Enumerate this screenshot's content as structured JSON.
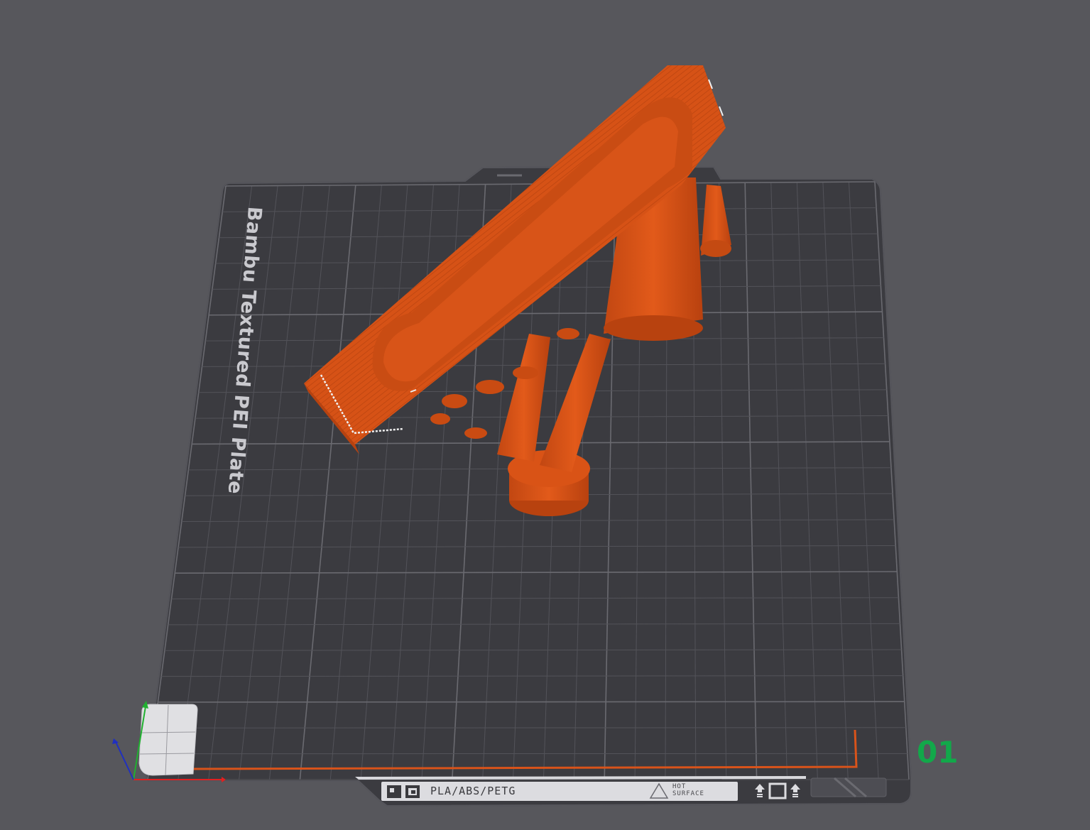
{
  "viewport": {
    "plate_label": "Bambu Textured PEI Plate",
    "plate_number": "01",
    "sticker": {
      "material_text": "PLA/ABS/PETG",
      "warning_line1": "HOT",
      "warning_line2": "SURFACE"
    }
  },
  "colors": {
    "background": "#57575c",
    "plate": "#3b3b40",
    "grid": "#5a5a60",
    "model": "#d95316",
    "model_dark": "#b34310",
    "plate_number": "#12a84a",
    "axis_x": "#e02020",
    "axis_y": "#20b030",
    "axis_z": "#2030c0"
  }
}
